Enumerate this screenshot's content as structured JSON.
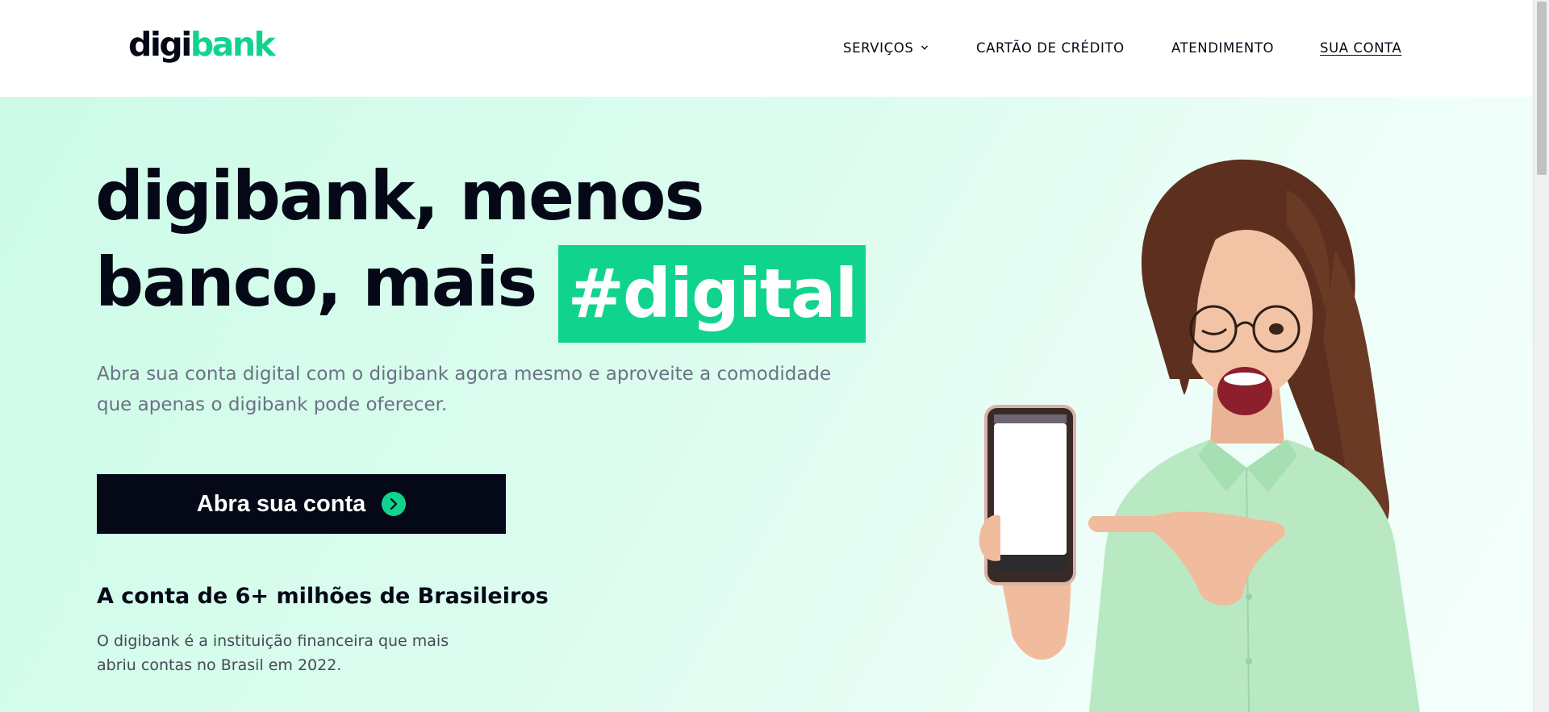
{
  "header": {
    "logo_part1": "digi",
    "logo_part2": "bank",
    "nav": {
      "servicos": "SERVIÇOS",
      "cartao": "CARTÃO DE CRÉDITO",
      "atendimento": "ATENDIMENTO",
      "conta": "SUA CONTA"
    }
  },
  "hero": {
    "headline_line1": "digibank, menos",
    "headline_line2_prefix": "banco, mais",
    "headline_highlight": "#digital",
    "subtext": "Abra sua conta digital com o digibank agora mesmo e aproveite a comodidade que apenas o digibank pode oferecer.",
    "cta_label": "Abra sua conta",
    "stat_heading": "A conta de 6+ milhões de Brasileiros",
    "stat_description": "O digibank é a instituição financeira que mais abriu contas no Brasil em 2022."
  },
  "colors": {
    "brand_green": "#10d48e",
    "dark": "#050816",
    "muted_text": "#6b7283"
  },
  "icons": {
    "nav_dropdown": "chevron-down-icon",
    "cta": "arrow-right-circle-icon"
  }
}
